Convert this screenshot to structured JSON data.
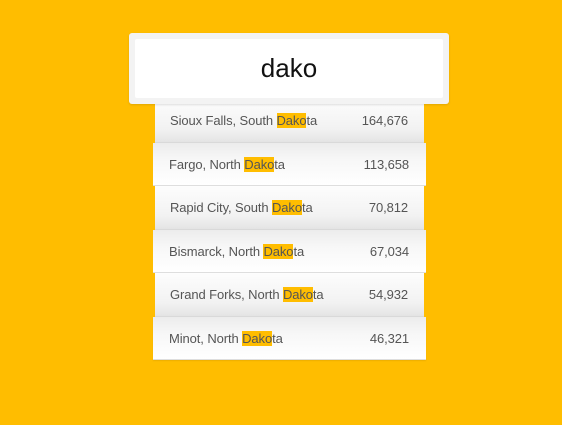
{
  "search": {
    "value": "dako",
    "placeholder": ""
  },
  "colors": {
    "background": "#ffbd00",
    "highlight": "#ffbd00"
  },
  "results": [
    {
      "pre": "Sioux Falls, South ",
      "match": "Dako",
      "post": "ta",
      "population": "164,676"
    },
    {
      "pre": "Fargo, North ",
      "match": "Dako",
      "post": "ta",
      "population": "113,658"
    },
    {
      "pre": "Rapid City, South ",
      "match": "Dako",
      "post": "ta",
      "population": "70,812"
    },
    {
      "pre": "Bismarck, North ",
      "match": "Dako",
      "post": "ta",
      "population": "67,034"
    },
    {
      "pre": "Grand Forks, North ",
      "match": "Dako",
      "post": "ta",
      "population": "54,932"
    },
    {
      "pre": "Minot, North ",
      "match": "Dako",
      "post": "ta",
      "population": "46,321"
    }
  ]
}
